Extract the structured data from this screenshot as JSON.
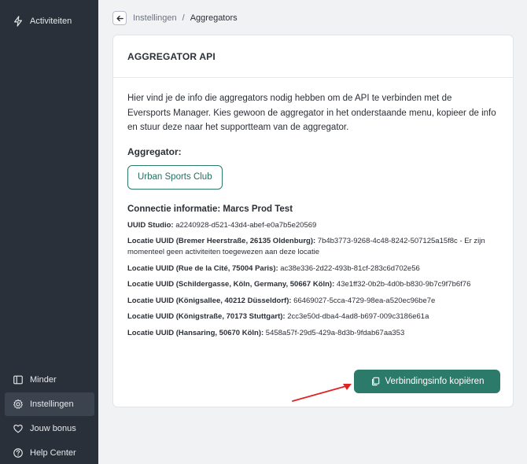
{
  "sidebar": {
    "items": [
      {
        "label": "Activiteiten",
        "icon": "bolt-icon"
      },
      {
        "label": "Minder",
        "icon": "collapse-icon"
      },
      {
        "label": "Instellingen",
        "icon": "gear-icon",
        "active": true
      },
      {
        "label": "Jouw bonus",
        "icon": "heart-icon"
      },
      {
        "label": "Help Center",
        "icon": "help-icon"
      }
    ]
  },
  "breadcrumb": {
    "parent": "Instellingen",
    "separator": "/",
    "current": "Aggregators"
  },
  "card": {
    "title": "AGGREGATOR API",
    "intro": "Hier vind je de info die aggregators nodig hebben om de API te verbinden met de Eversports Manager. Kies gewoon de aggregator in het onderstaande menu, kopieer de info en stuur deze naar het supportteam van de aggregator.",
    "aggregator_label": "Aggregator:",
    "aggregator_button": "Urban Sports Club",
    "connection_title": "Connectie informatie: Marcs Prod Test",
    "rows": [
      {
        "label": "UUID Studio:",
        "value": " a2240928-d521-43d4-abef-e0a7b5e20569"
      },
      {
        "label": "Locatie UUID (Bremer Heerstraße, 26135 Oldenburg):",
        "value": " 7b4b3773-9268-4c48-8242-507125a15f8c - Er zijn momenteel geen activiteiten toegewezen aan deze locatie"
      },
      {
        "label": "Locatie UUID (Rue de la Cité, 75004 Paris):",
        "value": " ac38e336-2d22-493b-81cf-283c6d702e56"
      },
      {
        "label": "Locatie UUID (Schildergasse, Köln, Germany, 50667 Köln):",
        "value": " 43e1ff32-0b2b-4d0b-b830-9b7c9f7b6f76"
      },
      {
        "label": "Locatie UUID (Königsallee, 40212 Düsseldorf):",
        "value": " 66469027-5cca-4729-98ea-a520ec96be7e"
      },
      {
        "label": "Locatie UUID (Königstraße, 70173 Stuttgart):",
        "value": " 2cc3e50d-dba4-4ad8-b697-009c3186e61a"
      },
      {
        "label": "Locatie UUID (Hansaring, 50670 Köln):",
        "value": " 5458a57f-29d5-429a-8d3b-9fdab67aa353"
      }
    ],
    "copy_button": "Verbindingsinfo kopiëren"
  },
  "colors": {
    "sidebar_bg": "#2a3039",
    "accent": "#2b7a6a",
    "arrow": "#e02424"
  }
}
